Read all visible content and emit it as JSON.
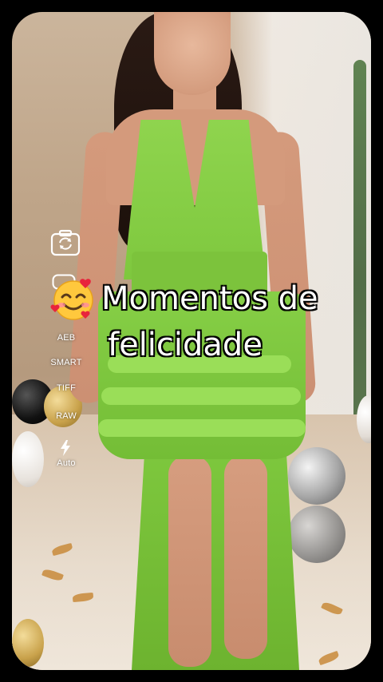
{
  "caption": {
    "emoji": "smiling-face-with-hearts",
    "line1": "Momentos de",
    "line2": "felicidade"
  },
  "camera_controls": {
    "items": [
      {
        "name": "switch-camera",
        "label": ""
      },
      {
        "name": "mode-toggle",
        "label": ""
      },
      {
        "name": "aeb",
        "label": "AEB"
      },
      {
        "name": "smart",
        "label": "SMART"
      },
      {
        "name": "tiff",
        "label": "TIFF"
      },
      {
        "name": "raw",
        "label": "RAW"
      },
      {
        "name": "flash",
        "label": "Auto"
      }
    ]
  },
  "colors": {
    "dress": "#7ec83e",
    "caption_text": "#ffffff",
    "caption_outline": "#000000",
    "frame_border": "#000000"
  }
}
